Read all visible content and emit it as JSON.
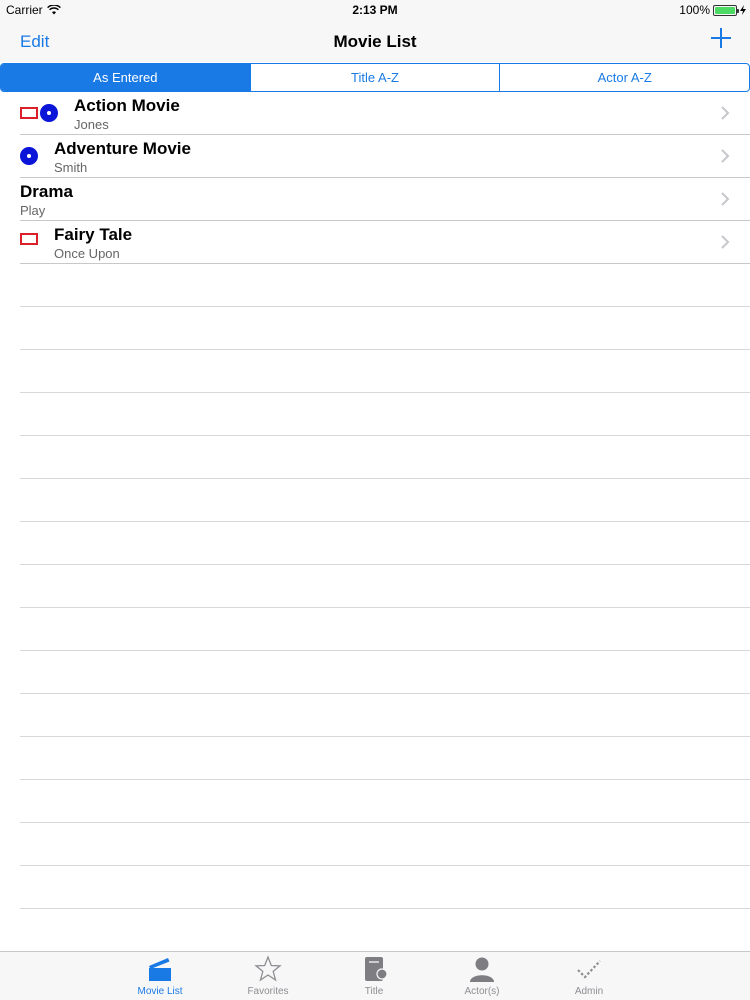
{
  "status_bar": {
    "carrier": "Carrier",
    "time": "2:13 PM",
    "battery": "100%",
    "battery_level": 1.0
  },
  "nav": {
    "edit_label": "Edit",
    "title": "Movie List",
    "add_icon": "plus-icon"
  },
  "segments": [
    {
      "label": "As Entered",
      "selected": true
    },
    {
      "label": "Title A-Z",
      "selected": false
    },
    {
      "label": "Actor A-Z",
      "selected": false
    }
  ],
  "movies": [
    {
      "title": "Action Movie",
      "subtitle": "Jones",
      "icons": [
        "tape-icon",
        "disc-icon"
      ]
    },
    {
      "title": "Adventure Movie",
      "subtitle": "Smith",
      "icons": [
        "disc-icon"
      ]
    },
    {
      "title": "Drama",
      "subtitle": "Play",
      "icons": []
    },
    {
      "title": "Fairy Tale",
      "subtitle": "Once Upon",
      "icons": [
        "tape-icon"
      ]
    }
  ],
  "tabs": [
    {
      "label": "Movie List",
      "icon": "clapperboard-icon",
      "selected": true
    },
    {
      "label": "Favorites",
      "icon": "star-icon",
      "selected": false
    },
    {
      "label": "Title",
      "icon": "book-icon",
      "selected": false
    },
    {
      "label": "Actor(s)",
      "icon": "person-icon",
      "selected": false
    },
    {
      "label": "Admin",
      "icon": "checkmark-icon",
      "selected": false
    }
  ],
  "colors": {
    "accent": "#1a7ae5",
    "tape": "#d9202b",
    "disc": "#0a15d8",
    "battery": "#4cd964"
  }
}
